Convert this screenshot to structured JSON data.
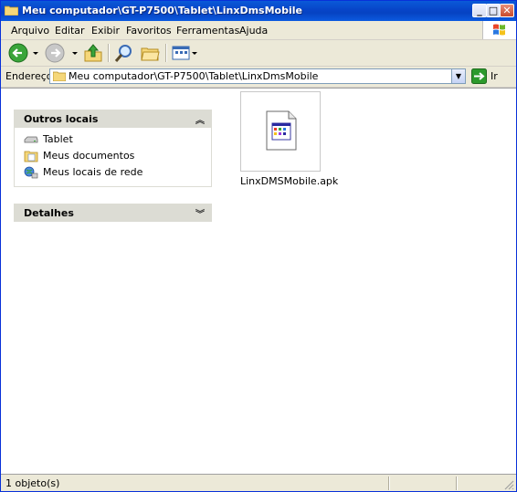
{
  "window": {
    "title": "Meu computador\\GT-P7500\\Tablet\\LinxDmsMobile",
    "min_glyph": "_",
    "max_glyph": "□",
    "close_glyph": "✕"
  },
  "menu": {
    "items": [
      {
        "label": "Arquivo"
      },
      {
        "label": "Editar"
      },
      {
        "label": "Exibir"
      },
      {
        "label": "Favoritos"
      },
      {
        "label": "Ferramentas"
      },
      {
        "label": "Ajuda"
      }
    ]
  },
  "toolbar": {
    "icons": [
      "back-icon",
      "forward-icon",
      "up-folder-icon",
      "search-icon",
      "folders-icon",
      "views-icon"
    ]
  },
  "address": {
    "label": "Endereço",
    "value": "Meu computador\\GT-P7500\\Tablet\\LinxDmsMobile",
    "go_label": "Ir"
  },
  "left_pane": {
    "other_places": {
      "title": "Outros locais",
      "chevron": "︽",
      "links": [
        {
          "label": "Tablet",
          "icon": "drive-icon"
        },
        {
          "label": "Meus documentos",
          "icon": "my-documents-icon"
        },
        {
          "label": "Meus locais de rede",
          "icon": "network-places-icon"
        }
      ]
    },
    "details": {
      "title": "Detalhes",
      "chevron": "︾"
    }
  },
  "files": [
    {
      "name": "LinxDMSMobile.apk",
      "icon": "apk-file-icon"
    }
  ],
  "status": {
    "text": "1 objeto(s)"
  },
  "colors": {
    "titlebar": "#0a5ad8",
    "panel_header": "#dcdcd4",
    "chrome": "#ece9d8",
    "go_green": "#2c9a2c"
  }
}
